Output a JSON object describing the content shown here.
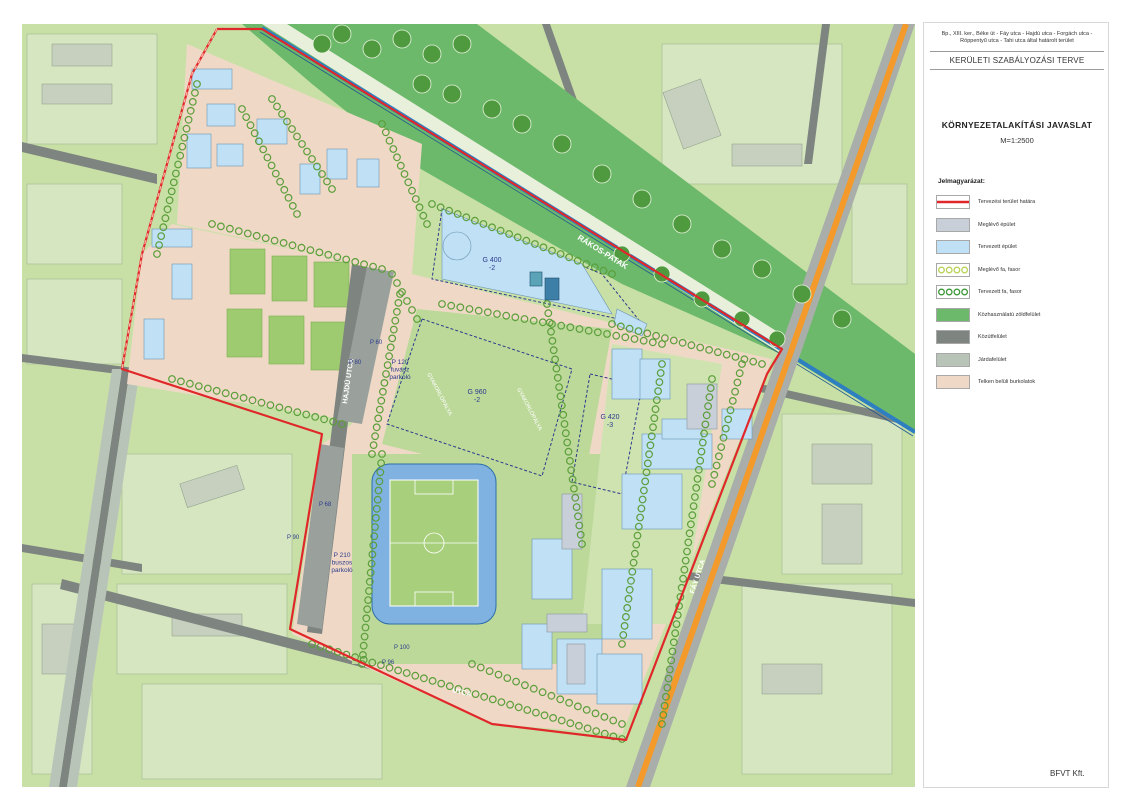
{
  "title_block": {
    "subtitle": "Bp., XIII. ker., Béke út - Fáy utca - Hajdú utca - Forgách utca - Röppentyű utca - Tahi utca által határolt terület",
    "plan_name": "KERÜLETI SZABÁLYOZÁSI TERVE",
    "map_title": "KÖRNYEZETALAKÍTÁSI JAVASLAT",
    "scale": "M=1:2500"
  },
  "legend": {
    "title": "Jelmagyarázat:",
    "items": [
      {
        "label": "Tervezési terület határa",
        "swatch": "boundary",
        "color": "#e0282a"
      },
      {
        "label": "Meglévő épület",
        "swatch": "fill",
        "color": "#c9cfd8"
      },
      {
        "label": "Tervezett épület",
        "swatch": "fill",
        "color": "#bfe0f5"
      },
      {
        "label": "Meglévő fa, fasor",
        "swatch": "trees-existing",
        "color": "#b9d35a"
      },
      {
        "label": "Tervezett fa, fasor",
        "swatch": "trees-planned",
        "color": "#3f9a3c"
      },
      {
        "label": "Közhasználatú zöldfelület",
        "swatch": "fill",
        "color": "#6db96b"
      },
      {
        "label": "Közútfelület",
        "swatch": "fill",
        "color": "#7e8480"
      },
      {
        "label": "Járdafelület",
        "swatch": "fill",
        "color": "#b9c4b8"
      },
      {
        "label": "Telken belüli burkolatok",
        "swatch": "fill",
        "color": "#efd9c6"
      }
    ]
  },
  "map_labels": {
    "stream": "RÁKOS-PATAK",
    "street_west": "HAJDÚ UTCA",
    "street_east": "FÁY UTCA",
    "street_south": "UTCA",
    "building_north": "G 400\n-2",
    "pitch_west": "GYAKORLÓPÁLYA",
    "pitch_east": "GYAKORLÓPÁLYA",
    "pitch_zone": "G 960\n-2",
    "zone_east": "G 420\n-3",
    "parking_north": "P 120\nfuvász\nparkoló",
    "parking_south": "P 210\nbuszos\nparkoló",
    "p80": "P 80",
    "p60": "P 60",
    "p68": "P 68",
    "p90": "P 90",
    "p100": "P 100",
    "p96": "P 96"
  },
  "colors": {
    "grass": "#c8e0a6",
    "lawn": "#a9d183",
    "park": "#6db96b",
    "road": "#7e8480",
    "sidewalk": "#b9c4b8",
    "paving": "#efd9c6",
    "building_new": "#bfe0f5",
    "building_old": "#c9cfd8",
    "boundary": "#e0282a",
    "stream_blue": "#2e7fc1",
    "road_orange": "#f39a2a",
    "stadium_blue": "#7fb2e0",
    "label_blue": "#2b3a8c"
  },
  "footer": {
    "company": "BFVT Kft."
  }
}
